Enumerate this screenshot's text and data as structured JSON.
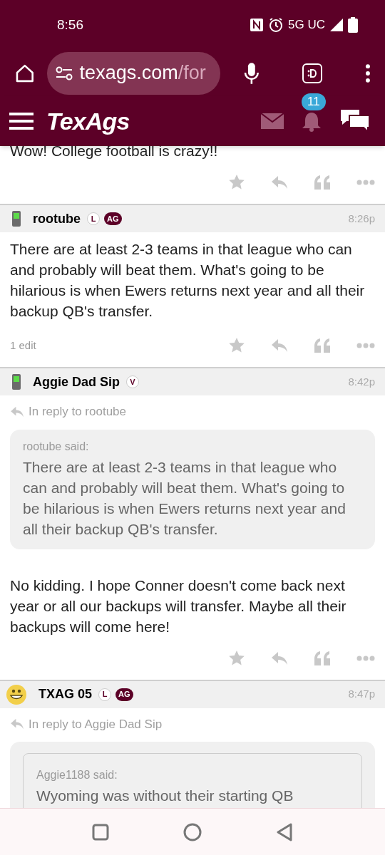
{
  "status_bar": {
    "time": "8:56",
    "network": "5G UC"
  },
  "browser": {
    "url_host": "texags.com",
    "url_path": "/for"
  },
  "site_header": {
    "logo": "TexAgs",
    "notification_count": "11"
  },
  "posts": [
    {
      "text": "Wow! College football is crazy!!"
    },
    {
      "avatar": {
        "kind": "phone"
      },
      "user": "rootube",
      "badges": [
        {
          "label": "L",
          "kind": "outline"
        },
        {
          "label": "AG",
          "kind": "filled"
        }
      ],
      "time": "8:26p",
      "text": "There are at least 2-3 teams in that league who can and probably will beat them. What's going to be hilarious is when Ewers returns next year and all their backup QB's transfer.",
      "edits": "1 edit"
    },
    {
      "avatar": {
        "kind": "phone"
      },
      "user": "Aggie Dad Sip",
      "badges": [
        {
          "label": "V",
          "kind": "outline"
        }
      ],
      "time": "8:42p",
      "reply_to": "In reply to rootube",
      "quote": {
        "nested": false,
        "author": "rootube said:",
        "text": "There are at least 2-3 teams in that league who can and probably will beat them. What's going to be hilarious is when Ewers returns next year and all their backup QB's transfer."
      },
      "text": "No kidding. I hope Conner doesn't come back next year or all our backups will transfer. Maybe all their backups will come here!"
    },
    {
      "avatar": {
        "kind": "smiley"
      },
      "user": "TXAG 05",
      "badges": [
        {
          "label": "L",
          "kind": "outline"
        },
        {
          "label": "AG",
          "kind": "filled"
        }
      ],
      "time": "8:47p",
      "reply_to": "In reply to Aggie Dad Sip",
      "quote": {
        "nested": true,
        "author": "Aggie1188 said:",
        "text": "Wyoming was without their starting QB"
      }
    }
  ]
}
